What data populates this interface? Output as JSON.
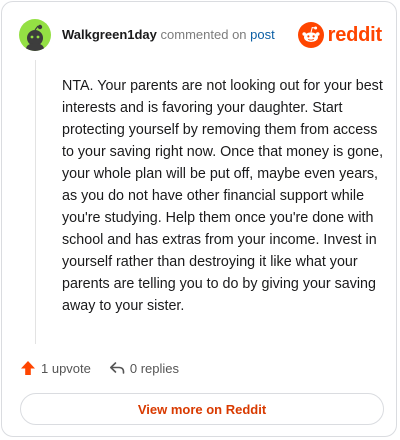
{
  "comment": {
    "username": "Walkgreen1day",
    "commented_text": "commented on",
    "post_link": "post",
    "avatar_icon": "snoo-avatar-icon",
    "body": "NTA. Your parents are not looking out for your best interests and is favoring your daughter. Start protecting yourself by removing them from access to your saving right now. Once that money is gone, your whole plan will be put off, maybe even years, as you do not have other financial support while you're studying. Help them once you're done with school and has extras from your income. Invest in yourself rather than destroying it like what your parents are telling you to do by giving your saving away to your sister."
  },
  "brand": {
    "wordmark": "reddit",
    "icon": "reddit-logo-icon",
    "color": "#ff4500"
  },
  "actions": {
    "upvotes": "1 upvote",
    "replies": "0 replies",
    "upvote_icon": "upvote-arrow-icon",
    "reply_icon": "reply-arrow-icon"
  },
  "footer": {
    "view_more": "View more on Reddit"
  },
  "colors": {
    "avatar_bg": "#94e044",
    "upvote": "#ff4500",
    "link": "#0b5fa5",
    "cta_text": "#d93a00"
  }
}
